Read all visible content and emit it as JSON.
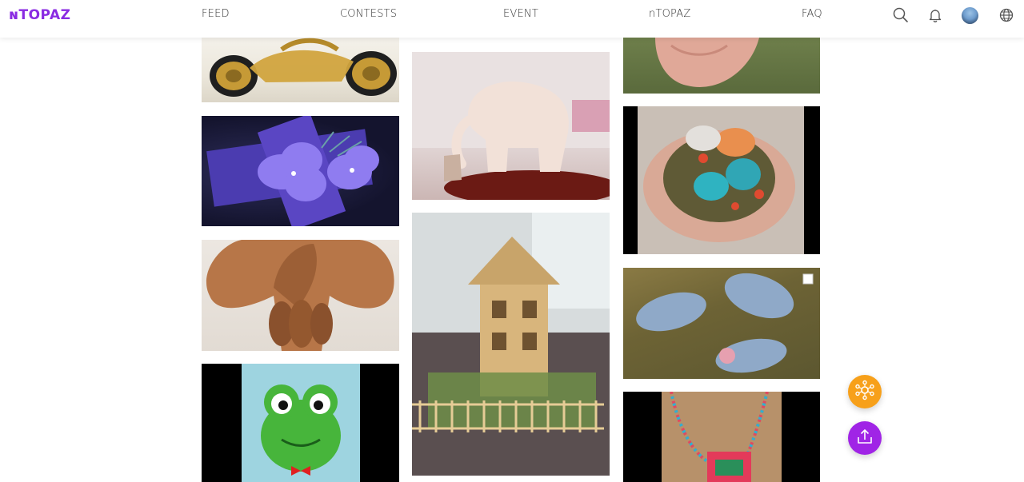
{
  "app": {
    "logo_text": "ɴTOPAZ",
    "accent_color": "#8a2be2"
  },
  "nav": {
    "items": [
      {
        "label": "FEED"
      },
      {
        "label": "CONTESTS"
      },
      {
        "label": "EVENT"
      },
      {
        "label": "nTOPAZ"
      },
      {
        "label": "FAQ"
      }
    ]
  },
  "header_icons": {
    "search": "search-icon",
    "notifications": "bell-icon",
    "avatar": "avatar",
    "language": "globe-icon"
  },
  "feed": {
    "columns": [
      {
        "tiles": [
          "gold wire motorcycle",
          "purple fabric flowers",
          "wooden carving",
          "crochet green frog keychain"
        ]
      },
      {
        "tiles": [
          "white elephant figurine",
          "popsicle stick house model"
        ]
      },
      {
        "tiles": [
          "hand on grass",
          "stone decorated ring",
          "denim plush animals",
          "beaded necklace"
        ]
      }
    ]
  },
  "fabs": {
    "network": {
      "icon": "network-icon",
      "color": "#f7a01a"
    },
    "upload": {
      "icon": "upload-icon",
      "color": "#a024e6"
    }
  }
}
